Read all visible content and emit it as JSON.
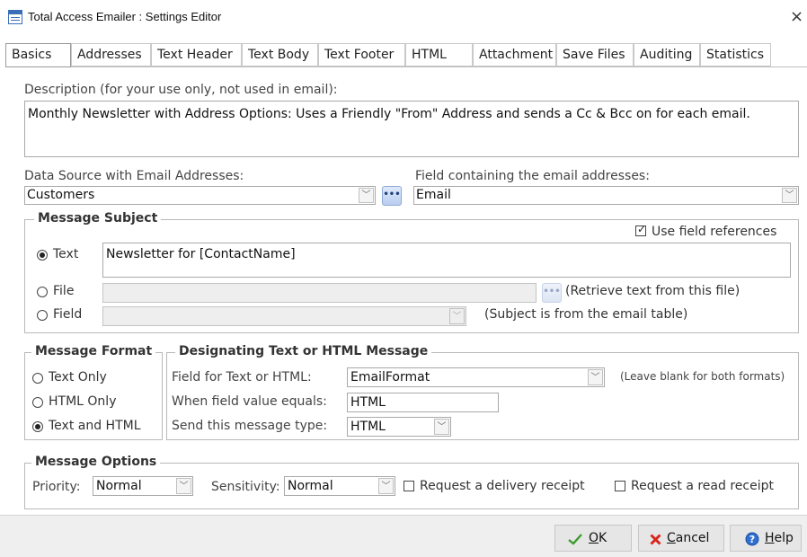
{
  "window": {
    "title": "Total Access Emailer : Settings Editor",
    "close_label": "×"
  },
  "tabs": [
    {
      "label": "Basics",
      "active": true
    },
    {
      "label": "Addresses"
    },
    {
      "label": "Text Header"
    },
    {
      "label": "Text Body"
    },
    {
      "label": "Text Footer"
    },
    {
      "label": "HTML"
    },
    {
      "label": "Attachment"
    },
    {
      "label": "Save Files"
    },
    {
      "label": "Auditing"
    },
    {
      "label": "Statistics"
    }
  ],
  "description": {
    "label": "Description (for your use only, not used in email):",
    "value": "Monthly Newsletter with Address Options: Uses a Friendly \"From\" Address and sends a Cc & Bcc on for each email."
  },
  "data_source": {
    "label": "Data Source with Email Addresses:",
    "value": "Customers",
    "ellipsis": "•••"
  },
  "email_field": {
    "label": "Field containing the email addresses:",
    "value": "Email"
  },
  "message_subject": {
    "title": "Message Subject",
    "use_field_refs_label": "Use field references",
    "use_field_refs_checked": true,
    "text_option": "Text",
    "text_value": "Newsletter for [ContactName]",
    "file_option": "File",
    "file_value": "",
    "file_ellipsis": "•••",
    "file_hint": "(Retrieve text from this file)",
    "field_option": "Field",
    "field_value": "",
    "field_hint": "(Subject is from the email table)",
    "selected": "Text"
  },
  "message_format": {
    "title": "Message Format",
    "options": [
      "Text Only",
      "HTML Only",
      "Text and HTML"
    ],
    "selected": "Text and HTML"
  },
  "designating": {
    "title": "Designating Text or HTML Message",
    "field_label": "Field for Text or HTML:",
    "field_value": "EmailFormat",
    "field_hint": "(Leave blank for both formats)",
    "equals_label": "When field value equals:",
    "equals_value": "HTML",
    "send_label": "Send this message type:",
    "send_value": "HTML"
  },
  "message_options": {
    "title": "Message Options",
    "priority_label": "Priority:",
    "priority_value": "Normal",
    "sensitivity_label": "Sensitivity:",
    "sensitivity_value": "Normal",
    "delivery_receipt_label": "Request a delivery receipt",
    "delivery_receipt_checked": false,
    "read_receipt_label": "Request a read receipt",
    "read_receipt_checked": false
  },
  "buttons": {
    "ok_hot": "O",
    "ok_rest": "K",
    "cancel_hot": "C",
    "cancel_rest": "ancel",
    "help_hot": "H",
    "help_rest": "elp"
  },
  "icons": {
    "dropdown": "chevron-down-icon",
    "ok": "checkmark-icon",
    "cancel": "x-icon",
    "help": "help-icon"
  },
  "colors": {
    "ok_check": "#3e9a2f",
    "cancel_x": "#d7261e",
    "help_blue": "#2f6fd1"
  }
}
